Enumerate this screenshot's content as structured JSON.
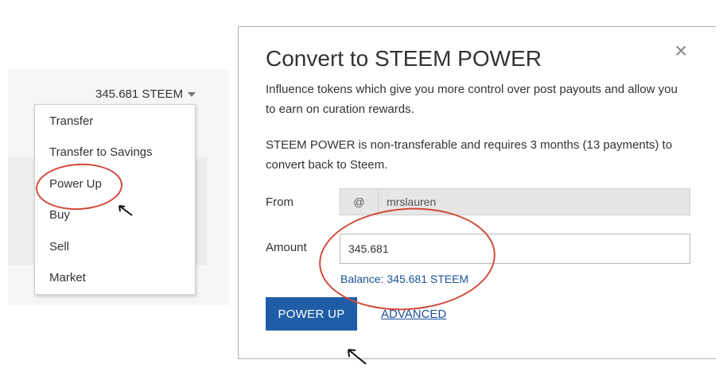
{
  "wallet": {
    "balance_label": "345.681 STEEM",
    "menu_items": [
      "Transfer",
      "Transfer to Savings",
      "Power Up",
      "Buy",
      "Sell",
      "Market"
    ]
  },
  "modal": {
    "title": "Convert to STEEM POWER",
    "close_label": "×",
    "description": "Influence tokens which give you more control over post payouts and allow you to earn on curation rewards.",
    "notice": "STEEM POWER is non-transferable and requires 3 months (13 payments) to convert back to Steem.",
    "from_label": "From",
    "at_symbol": "@",
    "from_value": "mrslauren",
    "amount_label": "Amount",
    "amount_value": "345.681",
    "balance_text": "Balance: 345.681 STEEM",
    "power_up_button": "POWER UP",
    "advanced_link": "ADVANCED"
  },
  "colors": {
    "accent": "#1f5ea6",
    "link": "#1a5099",
    "annotation": "#d24a3a"
  }
}
